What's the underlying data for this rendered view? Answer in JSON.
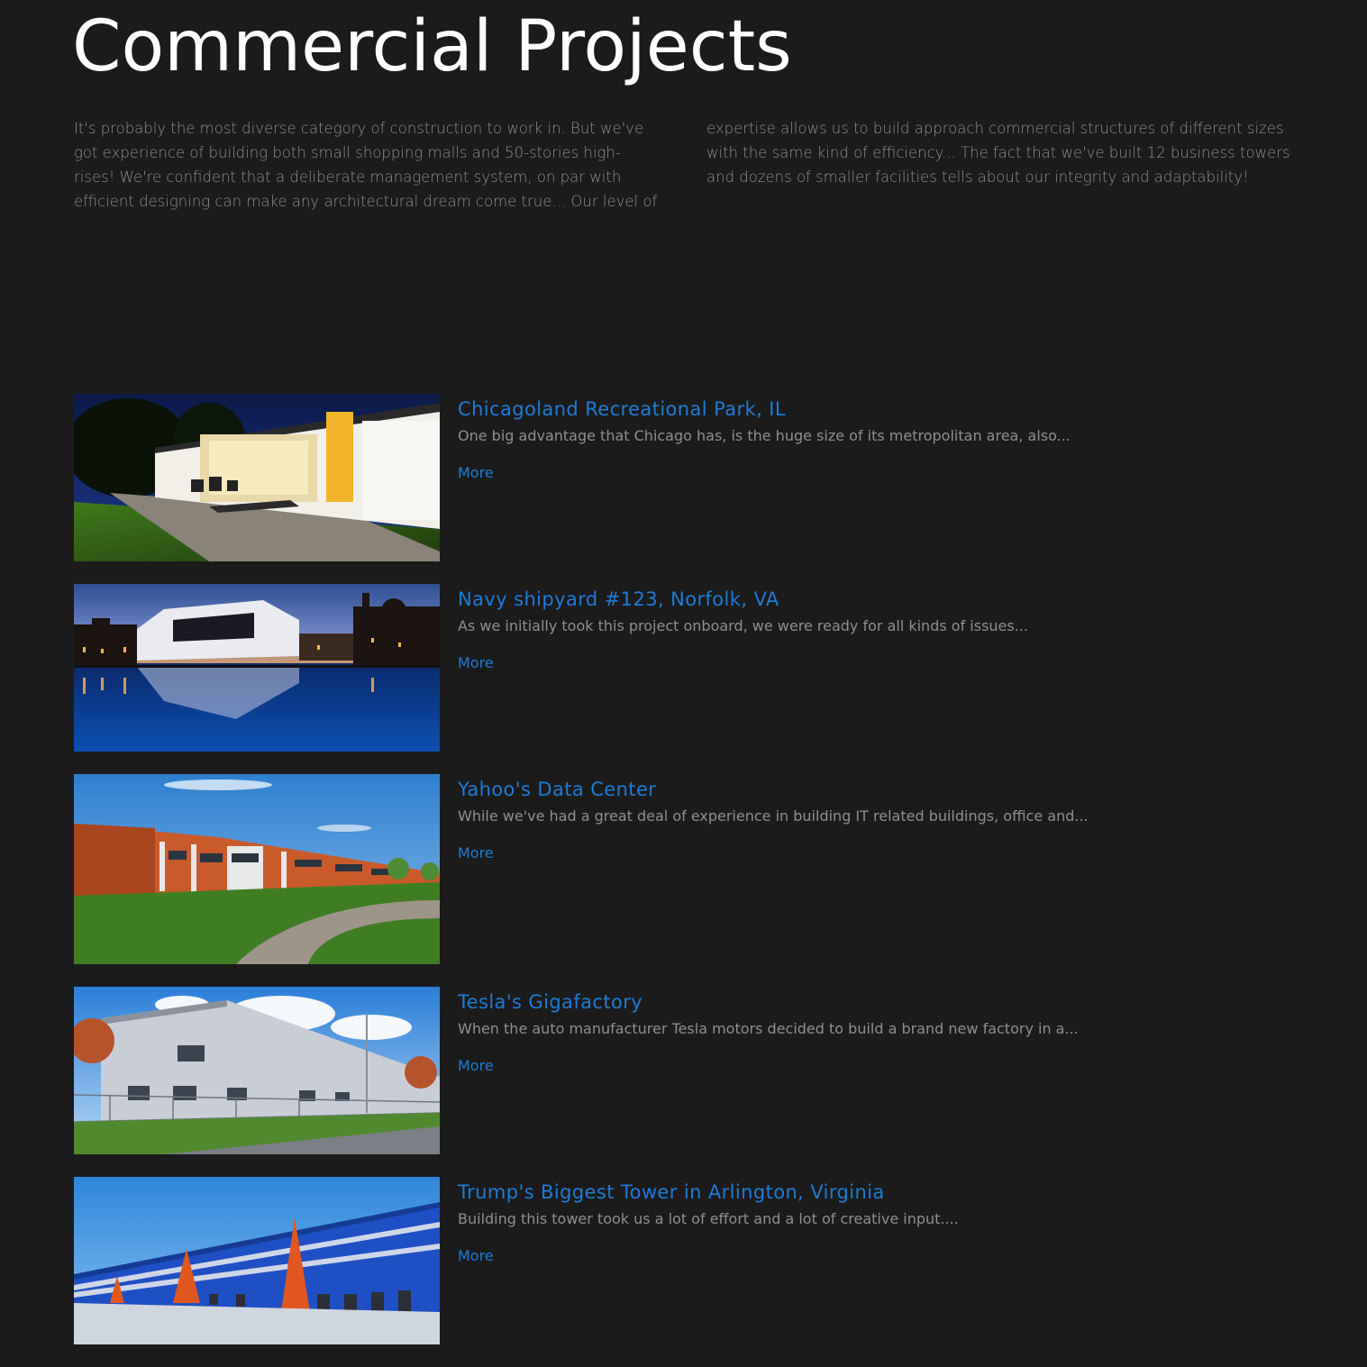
{
  "page": {
    "title": "Commercial Projects",
    "intro_left": "It's probably the most diverse category of construction to work in. But we've got experience of building both small shopping malls and 50-stories high-rises! We're confident that a deliberate management system, on par with efficient designing can make any architectural dream come true... Our level of",
    "intro_right": "expertise allows us to build approach commercial structures of different sizes with the same kind of efficiency... The fact that we've built 12 business towers and dozens of smaller facilities tells about our integrity and adaptability!"
  },
  "colors": {
    "background": "#1b1b1b",
    "accent": "#1e7cd8",
    "body_text": "#8f8f8f",
    "heading": "#ffffff"
  },
  "projects": [
    {
      "title": "Chicagoland Recreational Park, IL",
      "description": "One big advantage that Chicago has, is the huge size of its metropolitan area, also...",
      "more_label": "More",
      "image": "modern-house-night-photo"
    },
    {
      "title": "Navy shipyard #123, Norfolk, VA",
      "description": "As we initially took this project onboard, we were ready for all kinds of issues...",
      "more_label": "More",
      "image": "waterfront-buildings-reflection-photo"
    },
    {
      "title": "Yahoo's Data Center",
      "description": "While we've had a great deal of experience in building IT related buildings, office and...",
      "more_label": "More",
      "image": "brick-office-building-photo"
    },
    {
      "title": "Tesla's Gigafactory",
      "description": "When the auto manufacturer Tesla motors decided to build a brand new factory in a...",
      "more_label": "More",
      "image": "grey-warehouse-photo"
    },
    {
      "title": "Trump's Biggest Tower in Arlington, Virginia",
      "description": "Building this tower took us a lot of effort and a lot of creative input....",
      "more_label": "More",
      "image": "blue-warehouse-photo"
    }
  ]
}
